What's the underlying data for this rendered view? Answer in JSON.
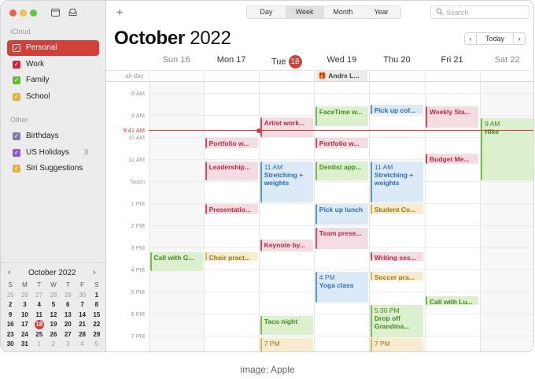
{
  "sidebar": {
    "section_icloud": "iCloud",
    "section_other": "Other",
    "calendars": [
      {
        "label": "Personal",
        "color": "#d0413a"
      },
      {
        "label": "Work",
        "color": "#c8283c"
      },
      {
        "label": "Family",
        "color": "#65b838"
      },
      {
        "label": "School",
        "color": "#e3b043"
      }
    ],
    "other_calendars": [
      {
        "label": "Birthdays",
        "color": "#7a7aa8"
      },
      {
        "label": "US Holidays",
        "color": "#8e5bc8"
      },
      {
        "label": "Siri Suggestions",
        "color": "#e3b043"
      }
    ]
  },
  "mini_calendar": {
    "title": "October 2022",
    "weekdays": [
      "S",
      "M",
      "T",
      "W",
      "T",
      "F",
      "S"
    ],
    "days": [
      "25",
      "26",
      "27",
      "28",
      "29",
      "30",
      "1",
      "2",
      "3",
      "4",
      "5",
      "6",
      "7",
      "8",
      "9",
      "10",
      "11",
      "12",
      "13",
      "14",
      "15",
      "16",
      "17",
      "18",
      "19",
      "20",
      "21",
      "22",
      "23",
      "24",
      "25",
      "26",
      "27",
      "28",
      "29",
      "30",
      "31",
      "1",
      "2",
      "3",
      "4",
      "5"
    ]
  },
  "toolbar": {
    "views": [
      "Day",
      "Week",
      "Month",
      "Year"
    ],
    "active_view": "Week",
    "search_placeholder": "Search",
    "today_label": "Today"
  },
  "header": {
    "month": "October",
    "year": "2022"
  },
  "days": [
    {
      "name": "Sun",
      "num": "16"
    },
    {
      "name": "Mon",
      "num": "17"
    },
    {
      "name": "Tue",
      "num": "18"
    },
    {
      "name": "Wed",
      "num": "19"
    },
    {
      "name": "Thu",
      "num": "20"
    },
    {
      "name": "Fri",
      "num": "21"
    },
    {
      "name": "Sat",
      "num": "22"
    }
  ],
  "all_day_label": "all-day",
  "all_day_events": [
    {
      "day": 3,
      "title": "Andre L...",
      "icon": "gift-icon"
    }
  ],
  "hours": [
    "8 AM",
    "9 AM",
    "10 AM",
    "11 AM",
    "Noon",
    "1 PM",
    "2 PM",
    "3 PM",
    "4 PM",
    "5 PM",
    "6 PM",
    "7 PM"
  ],
  "now_label": "9:41 AM",
  "events": [
    {
      "day": 2,
      "start": 9.1,
      "end": 10.05,
      "title": "Artist work...",
      "color": "red"
    },
    {
      "day": 3,
      "start": 8.6,
      "end": 9.55,
      "title": "FaceTime w...",
      "color": "green"
    },
    {
      "day": 4,
      "start": 8.55,
      "end": 9.0,
      "title": "Pick up cof...",
      "color": "blue"
    },
    {
      "day": 5,
      "start": 8.6,
      "end": 9.6,
      "title": "Weekly Sta...",
      "color": "red"
    },
    {
      "day": 6,
      "start": 9.15,
      "end": 12.0,
      "time": "9 AM",
      "title": "Hike",
      "color": "green"
    },
    {
      "day": 1,
      "start": 10.05,
      "end": 10.55,
      "title": "Portfolio w...",
      "color": "red"
    },
    {
      "day": 3,
      "start": 10.05,
      "end": 10.55,
      "title": "Portfolio w...",
      "color": "red"
    },
    {
      "day": 5,
      "start": 10.75,
      "end": 11.25,
      "title": "Budget Me...",
      "color": "red"
    },
    {
      "day": 1,
      "start": 11.1,
      "end": 12.0,
      "title": "Leadership...",
      "color": "red"
    },
    {
      "day": 2,
      "start": 11.1,
      "end": 13.0,
      "time": "11 AM",
      "title": "Stretching + weights",
      "color": "blue"
    },
    {
      "day": 3,
      "start": 11.1,
      "end": 12.0,
      "title": "Dentist app...",
      "color": "green"
    },
    {
      "day": 4,
      "start": 11.1,
      "end": 13.0,
      "time": "11 AM",
      "title": "Stretching + weights",
      "color": "blue"
    },
    {
      "day": 1,
      "start": 13.05,
      "end": 13.55,
      "title": "Presentatio...",
      "color": "red"
    },
    {
      "day": 3,
      "start": 13.05,
      "end": 14.0,
      "title": "Pick up lunch",
      "color": "blue"
    },
    {
      "day": 4,
      "start": 13.05,
      "end": 13.55,
      "title": "Student Co...",
      "color": "yellow"
    },
    {
      "day": 3,
      "start": 14.1,
      "end": 15.1,
      "title": "Team prese...",
      "color": "red"
    },
    {
      "day": 2,
      "start": 14.65,
      "end": 15.2,
      "title": "Keynote by...",
      "color": "red"
    },
    {
      "day": 0,
      "start": 15.2,
      "end": 16.1,
      "title": "Call with G...",
      "color": "green"
    },
    {
      "day": 1,
      "start": 15.2,
      "end": 15.65,
      "title": "Choir pract...",
      "color": "yellow"
    },
    {
      "day": 4,
      "start": 15.2,
      "end": 15.65,
      "title": "Writing ses...",
      "color": "red"
    },
    {
      "day": 3,
      "start": 16.1,
      "end": 17.55,
      "time": "4 PM",
      "title": "Yoga class",
      "color": "blue"
    },
    {
      "day": 4,
      "start": 16.1,
      "end": 16.55,
      "title": "Soccer pra...",
      "color": "yellow"
    },
    {
      "day": 5,
      "start": 17.2,
      "end": 17.65,
      "title": "Call with Lu...",
      "color": "green"
    },
    {
      "day": 4,
      "start": 17.6,
      "end": 19.1,
      "time": "5:30 PM",
      "title": "Drop off Grandma...",
      "color": "green"
    },
    {
      "day": 2,
      "start": 18.1,
      "end": 19.0,
      "title": "Taco night",
      "color": "green"
    },
    {
      "day": 2,
      "start": 19.1,
      "end": 19.8,
      "time": "7 PM",
      "title": "",
      "color": "yellow"
    },
    {
      "day": 4,
      "start": 19.1,
      "end": 19.8,
      "time": "7 PM",
      "title": "",
      "color": "yellow"
    }
  ],
  "credit": "image: Apple"
}
